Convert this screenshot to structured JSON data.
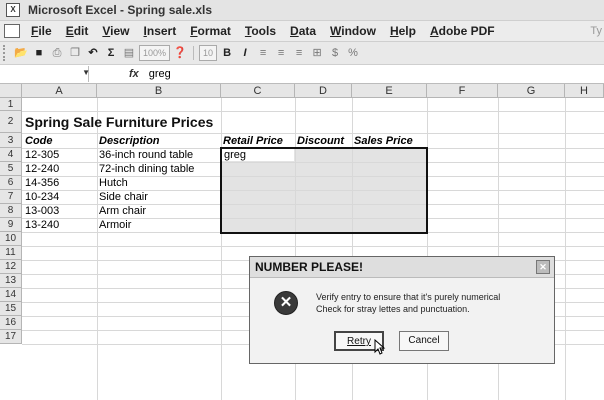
{
  "window": {
    "title": "Microsoft Excel - Spring sale.xls"
  },
  "menu": {
    "items": [
      "File",
      "Edit",
      "View",
      "Insert",
      "Format",
      "Tools",
      "Data",
      "Window",
      "Help",
      "Adobe PDF"
    ],
    "overflow_text": "Ty"
  },
  "toolbar": {
    "zoom": "100%",
    "font_size": "10",
    "bold": "B",
    "italic": "I",
    "sum": "Σ",
    "currency": "$",
    "percent": "%"
  },
  "formula_bar": {
    "fx_label": "fx",
    "value": "greg"
  },
  "sheet": {
    "columns": [
      "A",
      "B",
      "C",
      "D",
      "E",
      "F",
      "G",
      "H"
    ],
    "rows": [
      "1",
      "2",
      "3",
      "4",
      "5",
      "6",
      "7",
      "8",
      "9",
      "10",
      "11",
      "12",
      "13",
      "14",
      "15",
      "16",
      "17"
    ],
    "title": "Spring Sale Furniture Prices",
    "headers": {
      "code": "Code",
      "description": "Description",
      "retail": "Retail Price",
      "discount": "Discount",
      "sales": "Sales Price"
    },
    "data": [
      {
        "code": "12-305",
        "description": "36-inch round table"
      },
      {
        "code": "12-240",
        "description": "72-inch dining table"
      },
      {
        "code": "14-356",
        "description": "Hutch"
      },
      {
        "code": "10-234",
        "description": "Side chair"
      },
      {
        "code": "13-003",
        "description": "Arm chair"
      },
      {
        "code": "13-240",
        "description": "Armoir"
      }
    ],
    "active_cell_value": "greg"
  },
  "dialog": {
    "title": "NUMBER PLEASE!",
    "message_line1": "Verify entry to ensure that it's purely numerical",
    "message_line2": "Check for stray lettes and punctuation.",
    "retry_label": "Retry",
    "cancel_label": "Cancel"
  }
}
